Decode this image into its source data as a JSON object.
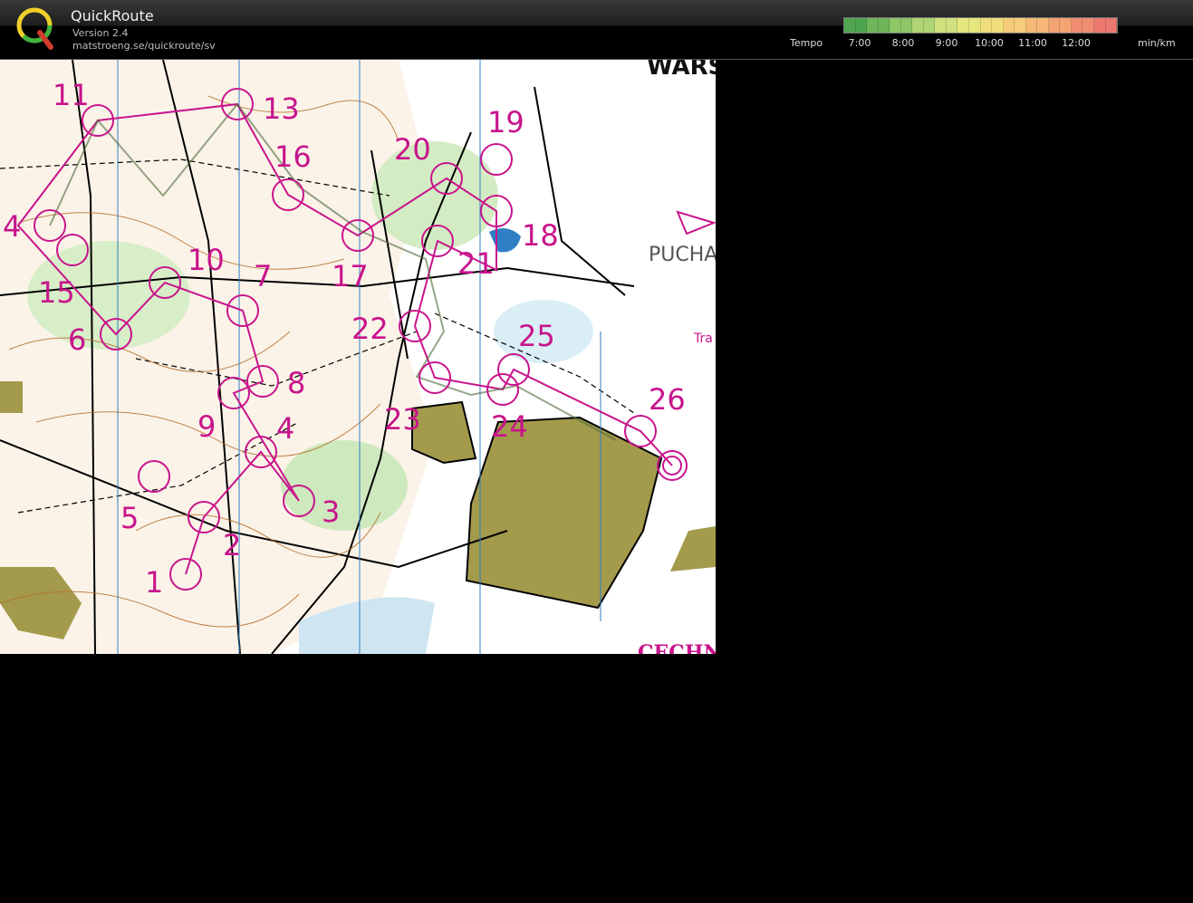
{
  "app": {
    "title": "QuickRoute",
    "version": "Version 2.4",
    "url": "matstroeng.se/quickroute/sv"
  },
  "tempo": {
    "label": "Tempo",
    "unit": "min/km",
    "ticks": [
      "7:00",
      "8:00",
      "9:00",
      "10:00",
      "11:00",
      "12:00"
    ],
    "colors": [
      "#4fa54f",
      "#6fb55a",
      "#8ec668",
      "#aed373",
      "#cfe07f",
      "#e6e67e",
      "#f0de7c",
      "#f5cc79",
      "#f5b877",
      "#f3a374",
      "#f08d72",
      "#ec7870"
    ]
  },
  "map": {
    "controls": [
      {
        "num": "1"
      },
      {
        "num": "2"
      },
      {
        "num": "3"
      },
      {
        "num": "4"
      },
      {
        "num": "4"
      },
      {
        "num": "5"
      },
      {
        "num": "6"
      },
      {
        "num": "7"
      },
      {
        "num": "8"
      },
      {
        "num": "9"
      },
      {
        "num": "10"
      },
      {
        "num": "11"
      },
      {
        "num": "13"
      },
      {
        "num": "15"
      },
      {
        "num": "16"
      },
      {
        "num": "17"
      },
      {
        "num": "18"
      },
      {
        "num": "19"
      },
      {
        "num": "20"
      },
      {
        "num": "21"
      },
      {
        "num": "22"
      },
      {
        "num": "23"
      },
      {
        "num": "24"
      },
      {
        "num": "25"
      },
      {
        "num": "26"
      }
    ],
    "labels": {
      "warsaw": "WARS",
      "pucha": "PUCHA",
      "tra": "Tra",
      "cechn": "CECHN"
    },
    "colors": {
      "course": "#c8148c",
      "contour": "#b5702e",
      "open_land": "#a39a4c",
      "water": "#2f7fc4",
      "green": "#9fd48a"
    }
  }
}
